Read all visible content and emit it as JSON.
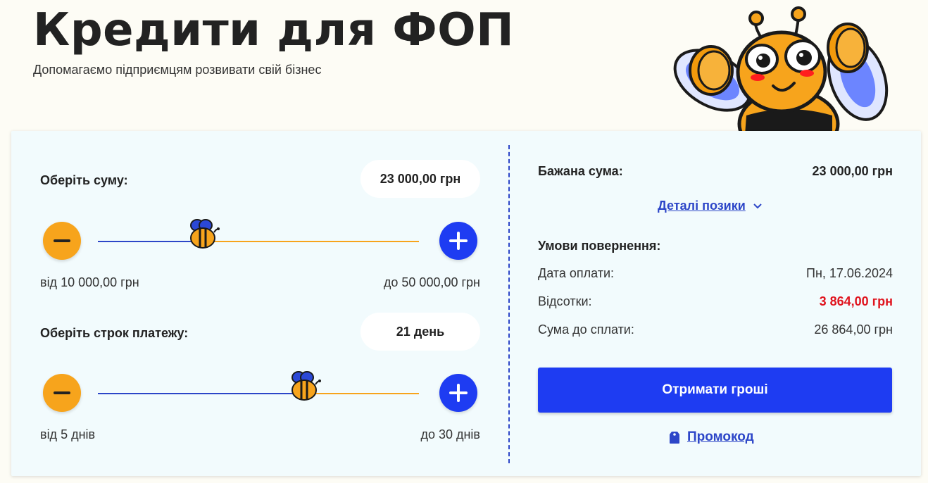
{
  "header": {
    "title": "Кредити для ФОП",
    "subtitle": "Допомагаємо підприємцям розвивати свій бізнес"
  },
  "calculator": {
    "amount": {
      "label": "Оберіть суму:",
      "value": "23 000,00 грн",
      "min_label": "від 10 000,00 грн",
      "max_label": "до 50 000,00 грн",
      "min": 10000,
      "max": 50000,
      "current": 23000
    },
    "term": {
      "label": "Оберіть строк платежу:",
      "value": "21 день",
      "min_label": "від 5 днів",
      "max_label": "до 30 днів",
      "min": 5,
      "max": 30,
      "current": 21
    }
  },
  "summary": {
    "desired_label": "Бажана сума:",
    "desired_value": "23 000,00 грн",
    "details_link": "Деталі позики",
    "conditions_title": "Умови повернення:",
    "rows": [
      {
        "label": "Дата оплати:",
        "value": "Пн, 17.06.2024"
      },
      {
        "label": "Відсотки:",
        "value": "3 864,00 грн"
      },
      {
        "label": "Сума до сплати:",
        "value": "26 864,00 грн"
      }
    ],
    "cta_label": "Отримати гроші",
    "promo_label": "Промокод"
  },
  "colors": {
    "accent_blue": "#1e3cf2",
    "accent_orange": "#f7a41c",
    "interest_red": "#e0141e"
  },
  "icons": [
    "minus-icon",
    "plus-icon",
    "bee-slider-thumb-icon",
    "chevron-down-icon",
    "tag-icon",
    "bee-mascot"
  ]
}
